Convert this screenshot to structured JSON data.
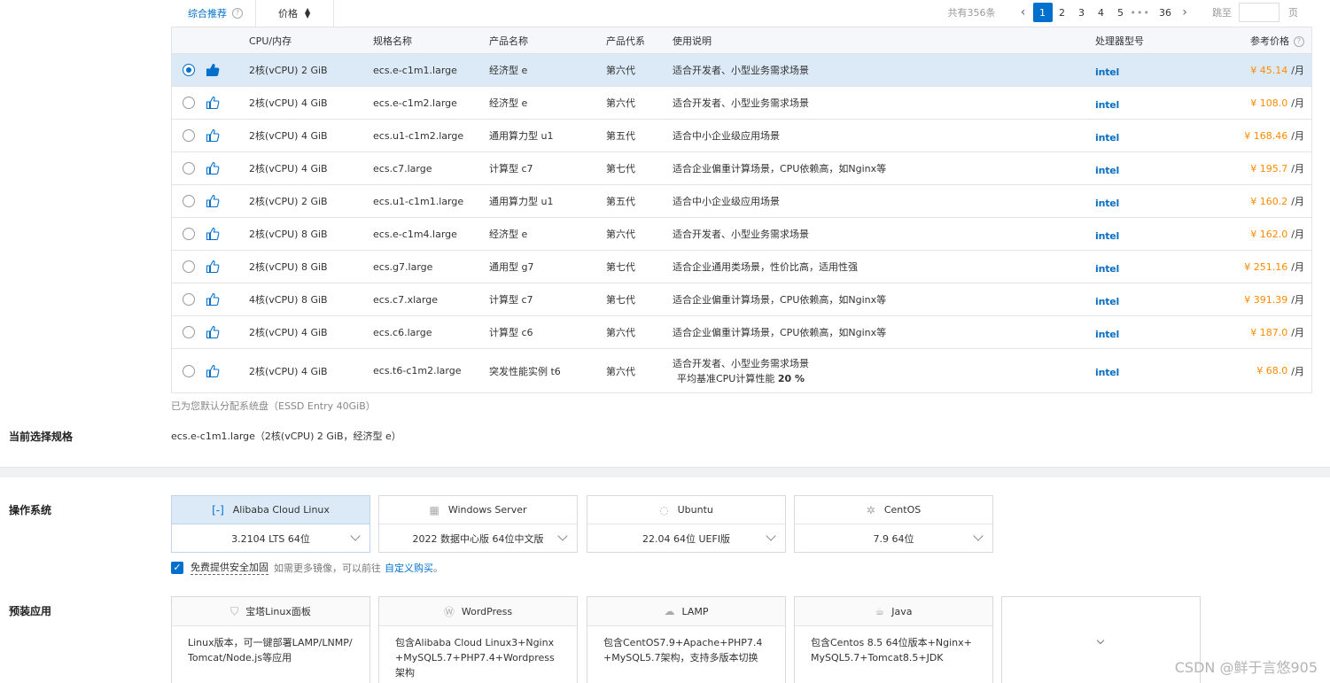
{
  "toolbar": {
    "sort_label": "综合推荐",
    "help_glyph": "?",
    "price_label": "价格",
    "pagination": {
      "total": "共有356条",
      "prev": "‹",
      "pages": [
        "1",
        "2",
        "3",
        "4",
        "5"
      ],
      "ellipsis": "•••",
      "last": "36",
      "next": "›",
      "jump_label": "跳至",
      "jump_value": "",
      "page_unit": "页",
      "current": "1"
    }
  },
  "table": {
    "headers": {
      "cpu": "CPU/内存",
      "spec": "规格名称",
      "product": "产品名称",
      "gen": "产品代系",
      "usage": "使用说明",
      "processor": "处理器型号",
      "price": "参考价格"
    },
    "rows": [
      {
        "cpu": "2核(vCPU) 2 GiB",
        "spec": "ecs.e-c1m1.large",
        "product": "经济型 e",
        "gen": "第六代",
        "usage": "适合开发者、小型业务需求场景",
        "processor": "intel",
        "price": "¥ 45.14",
        "unit": "/月",
        "selected": true
      },
      {
        "cpu": "2核(vCPU) 4 GiB",
        "spec": "ecs.e-c1m2.large",
        "product": "经济型 e",
        "gen": "第六代",
        "usage": "适合开发者、小型业务需求场景",
        "processor": "intel",
        "price": "¥ 108.0",
        "unit": "/月"
      },
      {
        "cpu": "2核(vCPU) 4 GiB",
        "spec": "ecs.u1-c1m2.large",
        "product": "通用算力型 u1",
        "gen": "第五代",
        "usage": "适合中小企业级应用场景",
        "processor": "intel",
        "price": "¥ 168.46",
        "unit": "/月"
      },
      {
        "cpu": "2核(vCPU) 4 GiB",
        "spec": "ecs.c7.large",
        "product": "计算型 c7",
        "gen": "第七代",
        "usage": "适合企业偏重计算场景，CPU依赖高，如Nginx等",
        "processor": "intel",
        "price": "¥ 195.7",
        "unit": "/月"
      },
      {
        "cpu": "2核(vCPU) 2 GiB",
        "spec": "ecs.u1-c1m1.large",
        "product": "通用算力型 u1",
        "gen": "第五代",
        "usage": "适合中小企业级应用场景",
        "processor": "intel",
        "price": "¥ 160.2",
        "unit": "/月"
      },
      {
        "cpu": "2核(vCPU) 8 GiB",
        "spec": "ecs.e-c1m4.large",
        "product": "经济型 e",
        "gen": "第六代",
        "usage": "适合开发者、小型业务需求场景",
        "processor": "intel",
        "price": "¥ 162.0",
        "unit": "/月"
      },
      {
        "cpu": "2核(vCPU) 8 GiB",
        "spec": "ecs.g7.large",
        "product": "通用型 g7",
        "gen": "第七代",
        "usage": "适合企业通用类场景，性价比高，适用性强",
        "processor": "intel",
        "price": "¥ 251.16",
        "unit": "/月"
      },
      {
        "cpu": "4核(vCPU) 8 GiB",
        "spec": "ecs.c7.xlarge",
        "product": "计算型 c7",
        "gen": "第七代",
        "usage": "适合企业偏重计算场景，CPU依赖高，如Nginx等",
        "processor": "intel",
        "price": "¥ 391.39",
        "unit": "/月"
      },
      {
        "cpu": "2核(vCPU) 4 GiB",
        "spec": "ecs.c6.large",
        "product": "计算型 c6",
        "gen": "第六代",
        "usage": "适合企业偏重计算场景，CPU依赖高，如Nginx等",
        "processor": "intel",
        "price": "¥ 187.0",
        "unit": "/月"
      },
      {
        "cpu": "2核(vCPU) 4 GiB",
        "spec": "ecs.t6-c1m2.large",
        "product": "突发性能实例 t6",
        "gen": "第六代",
        "usage": "适合开发者、小型业务需求场景",
        "usage_line2_prefix": "平均基准CPU计算性能 ",
        "usage_line2_bold": "20 %",
        "processor": "intel",
        "price": "¥ 68.0",
        "unit": "/月"
      }
    ]
  },
  "footnote": "已为您默认分配系统盘（ESSD Entry 40GiB）",
  "current_spec": {
    "label": "当前选择规格",
    "value": "ecs.e-c1m1.large（2核(vCPU) 2 GiB，经济型 e）"
  },
  "os": {
    "label": "操作系统",
    "cards": [
      {
        "name": "Alibaba Cloud Linux",
        "icon": "alibaba-cloud-icon",
        "version": "3.2104 LTS 64位",
        "active": true
      },
      {
        "name": "Windows Server",
        "icon": "windows-icon",
        "version": "2022 数据中心版 64位中文版"
      },
      {
        "name": "Ubuntu",
        "icon": "ubuntu-icon",
        "version": "22.04 64位 UEFI版"
      },
      {
        "name": "CentOS",
        "icon": "centos-icon",
        "version": "7.9 64位"
      }
    ],
    "secure_checked": true,
    "secure_label": "免费提供安全加固",
    "secure_hint": "如需更多镜像，可以前往",
    "secure_link": "自定义购买",
    "secure_tail": "。"
  },
  "apps": {
    "label": "预装应用",
    "cards": [
      {
        "name": "宝塔Linux面板",
        "icon": "baota-icon",
        "desc": "Linux版本，可一键部署LAMP/LNMP/Tomcat/Node.js等应用"
      },
      {
        "name": "WordPress",
        "icon": "wordpress-icon",
        "desc": "包含Alibaba Cloud Linux3+Nginx+MySQL5.7+PHP7.4+Wordpress架构"
      },
      {
        "name": "LAMP",
        "icon": "lamp-icon",
        "desc": "包含CentOS7.9+Apache+PHP7.4+MySQL5.7架构，支持多版本切换"
      },
      {
        "name": "Java",
        "icon": "java-icon",
        "desc": "包含Centos 8.5 64位版本+Nginx+MySQL5.7+Tomcat8.5+JDK"
      }
    ]
  },
  "watermark": "CSDN @鲜于言悠905",
  "colors": {
    "accent": "#0070cc",
    "price": "#ff8a00",
    "selected_row": "#dbeaf6"
  }
}
